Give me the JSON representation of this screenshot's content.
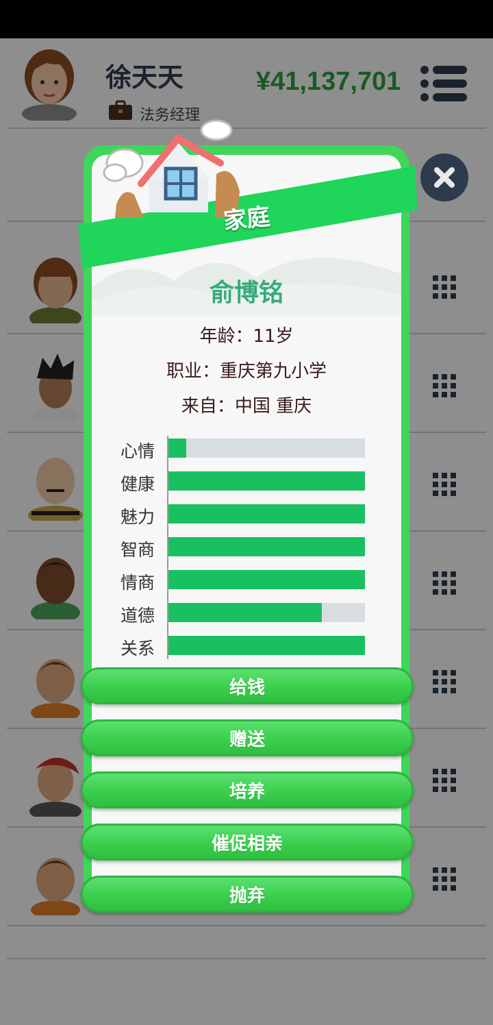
{
  "header": {
    "user_name": "徐天天",
    "job_title": "法务经理",
    "money": "¥41,137,701"
  },
  "modal": {
    "title": "家庭",
    "person": {
      "name": "俞博铭",
      "age_line": "年龄：11岁",
      "job_line": "职业：重庆第九小学",
      "from_line": "来自：中国 重庆"
    },
    "stats": [
      {
        "label": "心情",
        "fraction": 0.09
      },
      {
        "label": "健康",
        "fraction": 1.0
      },
      {
        "label": "魅力",
        "fraction": 1.0
      },
      {
        "label": "智商",
        "fraction": 1.0
      },
      {
        "label": "情商",
        "fraction": 1.0
      },
      {
        "label": "道德",
        "fraction": 0.78
      },
      {
        "label": "关系",
        "fraction": 1.0
      }
    ],
    "actions": [
      "给钱",
      "赠送",
      "培养",
      "催促相亲",
      "抛弃"
    ]
  },
  "colors": {
    "accent": "#3fd65a",
    "stat_fill": "#19c060",
    "name": "#35ab7a",
    "money": "#2b9a3e"
  },
  "icons": [
    "briefcase-icon",
    "menu-icon",
    "close-icon",
    "grid-menu-icon",
    "house-icon"
  ]
}
